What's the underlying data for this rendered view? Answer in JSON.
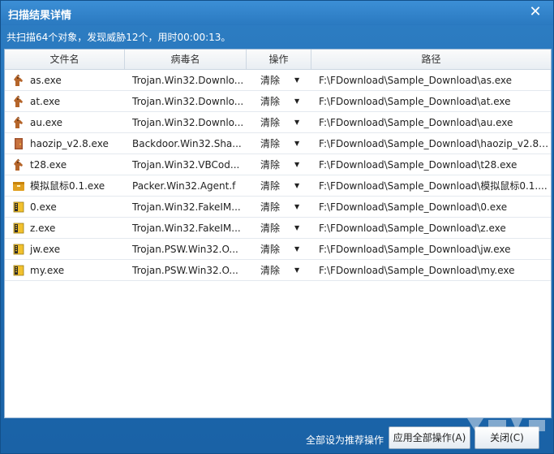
{
  "window": {
    "title": "扫描结果详情",
    "close_glyph": "✕"
  },
  "summary": "共扫描64个对象，发现威胁12个，用时00:00:13。",
  "columns": {
    "filename": "文件名",
    "virus": "病毒名",
    "action": "操作",
    "path": "路径"
  },
  "rows": [
    {
      "icon": "trojan-horse-icon",
      "file": "as.exe",
      "virus": "Trojan.Win32.Downlo...",
      "action": "清除",
      "path": "F:\\FDownload\\Sample_Download\\as.exe"
    },
    {
      "icon": "trojan-horse-icon",
      "file": "at.exe",
      "virus": "Trojan.Win32.Downlo...",
      "action": "清除",
      "path": "F:\\FDownload\\Sample_Download\\at.exe"
    },
    {
      "icon": "trojan-horse-icon",
      "file": "au.exe",
      "virus": "Trojan.Win32.Downlo...",
      "action": "清除",
      "path": "F:\\FDownload\\Sample_Download\\au.exe"
    },
    {
      "icon": "backdoor-icon",
      "file": "haozip_v2.8.exe",
      "virus": "Backdoor.Win32.Sha...",
      "action": "清除",
      "path": "F:\\FDownload\\Sample_Download\\haozip_v2.8...."
    },
    {
      "icon": "trojan-horse-icon",
      "file": "t28.exe",
      "virus": "Trojan.Win32.VBCod...",
      "action": "清除",
      "path": "F:\\FDownload\\Sample_Download\\t28.exe"
    },
    {
      "icon": "packer-icon",
      "file": "模拟鼠标0.1.exe",
      "virus": "Packer.Win32.Agent.f",
      "action": "清除",
      "path": "F:\\FDownload\\Sample_Download\\模拟鼠标0.1...."
    },
    {
      "icon": "archive-file-icon",
      "file": "0.exe",
      "virus": "Trojan.Win32.FakeIM...",
      "action": "清除",
      "path": "F:\\FDownload\\Sample_Download\\0.exe"
    },
    {
      "icon": "archive-file-icon",
      "file": "z.exe",
      "virus": "Trojan.Win32.FakeIM...",
      "action": "清除",
      "path": "F:\\FDownload\\Sample_Download\\z.exe"
    },
    {
      "icon": "archive-file-icon",
      "file": "jw.exe",
      "virus": "Trojan.PSW.Win32.O...",
      "action": "清除",
      "path": "F:\\FDownload\\Sample_Download\\jw.exe"
    },
    {
      "icon": "archive-file-icon",
      "file": "my.exe",
      "virus": "Trojan.PSW.Win32.O...",
      "action": "清除",
      "path": "F:\\FDownload\\Sample_Download\\my.exe"
    }
  ],
  "footer": {
    "set_all_label": "全部设为推荐操作",
    "apply_all_button": "应用全部操作(A)",
    "close_button": "关闭(C)"
  },
  "colors": {
    "window_bg": "#1e6cb3",
    "titlebar": "#2a79c0",
    "list_bg": "#ffffff"
  }
}
